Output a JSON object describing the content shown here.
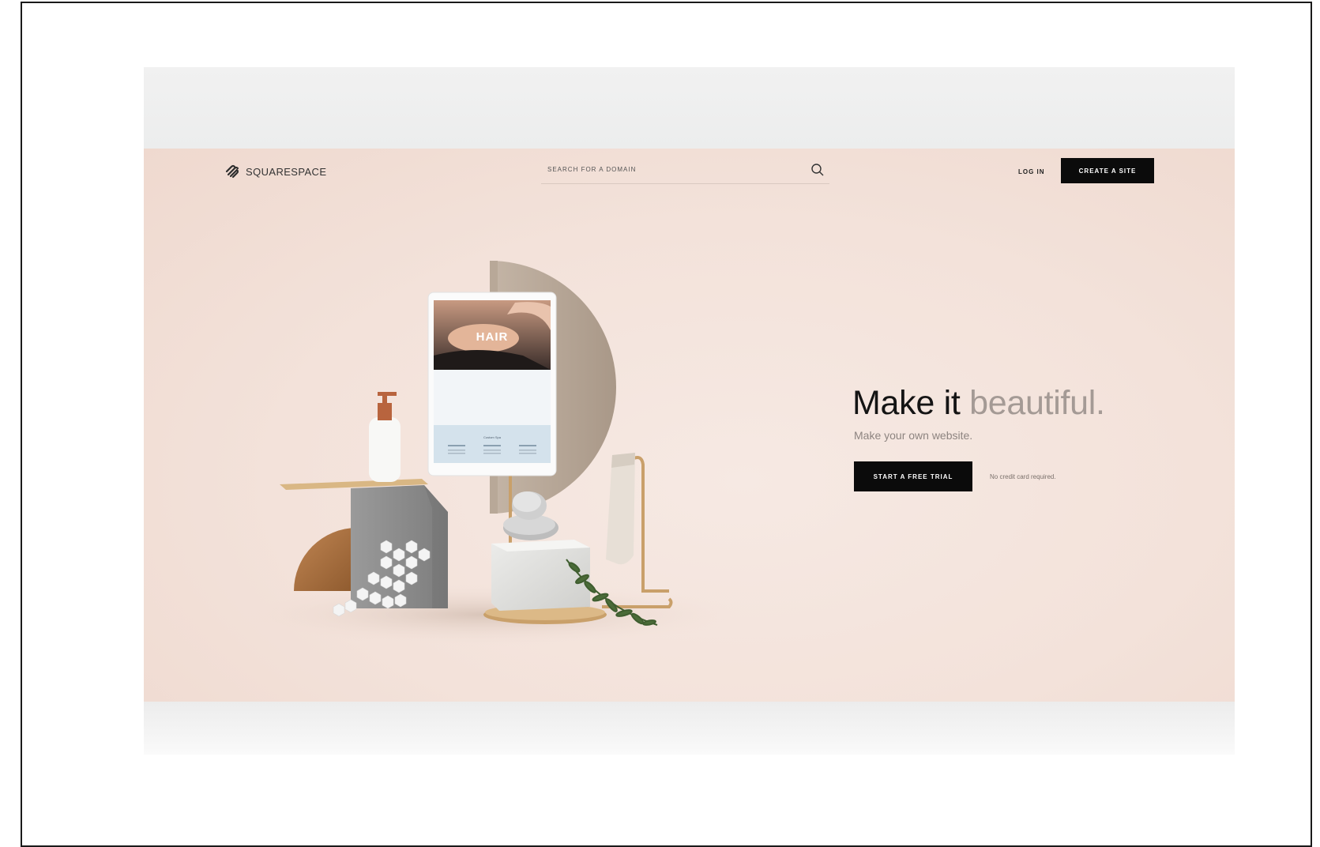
{
  "nav": {
    "logo_text": "SQUARESPACE",
    "search_placeholder": "SEARCH FOR A DOMAIN",
    "login_label": "LOG IN",
    "create_label": "CREATE A SITE"
  },
  "hero": {
    "headline_main": "Make it",
    "headline_accent": "beautiful.",
    "subheadline": "Make your own website.",
    "cta_label": "START A FREE TRIAL",
    "cta_note": "No credit card required."
  },
  "tablet": {
    "title": "HAIR"
  },
  "colors": {
    "accent": "#0b0b0b",
    "background": "#f3e2da",
    "headline_accent": "#a49a95"
  },
  "icons": {
    "logo": "squarespace-logo-icon",
    "search": "search-icon"
  }
}
